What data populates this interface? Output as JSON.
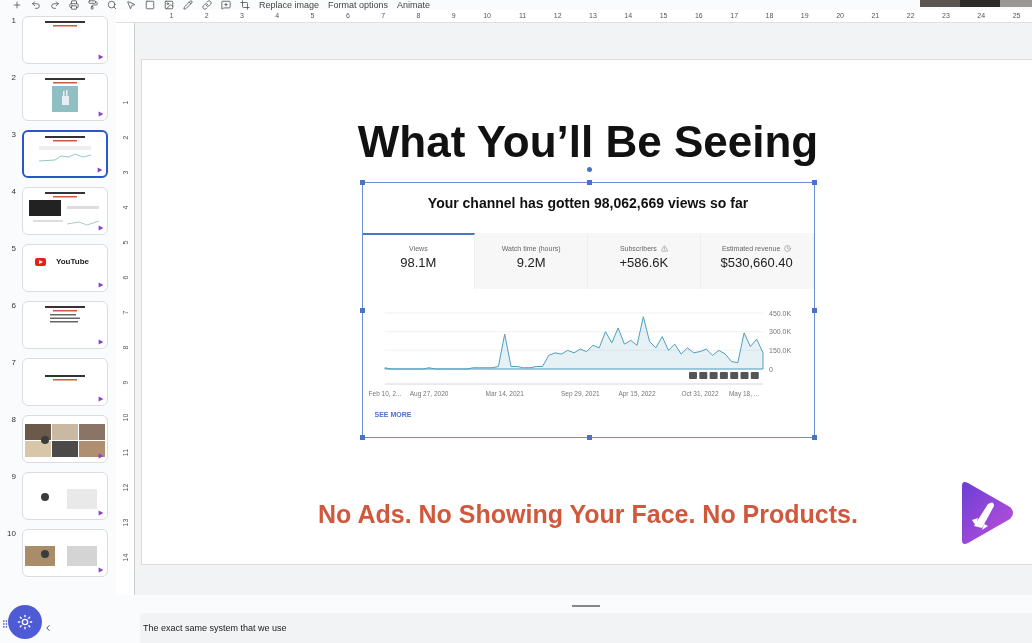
{
  "toolbar": {
    "buttons": [
      "Replace image",
      "Format options",
      "Animate"
    ]
  },
  "rulers": {
    "horizontal": [
      "1",
      "2",
      "3",
      "4",
      "5",
      "6",
      "7",
      "8",
      "9",
      "10",
      "11",
      "12",
      "13",
      "14",
      "15",
      "16",
      "17",
      "18",
      "19",
      "20",
      "21",
      "22",
      "23",
      "24",
      "25"
    ],
    "vertical": [
      "1",
      "2",
      "3",
      "4",
      "5",
      "6",
      "7",
      "8",
      "9",
      "10",
      "11",
      "12",
      "13",
      "14"
    ]
  },
  "slides": [
    {
      "number": "1",
      "kind": "title",
      "selected": false
    },
    {
      "number": "2",
      "selected": false
    },
    {
      "number": "3",
      "kind": "chart",
      "selected": true
    },
    {
      "number": "4",
      "kind": "screenshot",
      "selected": false
    },
    {
      "number": "5",
      "kind": "youtube",
      "selected": false,
      "title": "YouTube"
    },
    {
      "number": "6",
      "kind": "list",
      "selected": false
    },
    {
      "number": "7",
      "kind": "text",
      "selected": false
    },
    {
      "number": "8",
      "kind": "photos",
      "selected": false
    },
    {
      "number": "9",
      "kind": "split",
      "selected": false
    },
    {
      "number": "10",
      "kind": "photos2",
      "selected": false
    }
  ],
  "slide": {
    "title": "What You’ll Be Seeing",
    "caption": "No Ads. No Showing Your Face. No Products.",
    "analytics": {
      "headline": "Your channel has gotten 98,062,669 views so far",
      "tabs": [
        {
          "label": "Views",
          "value": "98.1M",
          "selected": true
        },
        {
          "label": "Watch time (hours)",
          "value": "9.2M",
          "selected": false
        },
        {
          "label": "Subscribers",
          "value": "+586.6K",
          "selected": false
        },
        {
          "label": "Estimated revenue",
          "value": "$530,660.40",
          "selected": false
        }
      ],
      "chart_data": {
        "type": "area",
        "categories": [
          "Feb 10, 2...",
          null,
          null,
          null,
          null,
          null,
          null,
          "Aug 27, 2020",
          null,
          null,
          null,
          null,
          null,
          null,
          null,
          null,
          null,
          null,
          null,
          "Mar 14, 2021",
          null,
          null,
          null,
          null,
          null,
          null,
          null,
          null,
          null,
          null,
          null,
          "Sep 29, 2021",
          null,
          null,
          null,
          null,
          null,
          null,
          null,
          null,
          "Apr 15, 2022",
          null,
          null,
          null,
          null,
          null,
          null,
          null,
          null,
          null,
          "Oct 31, 2022",
          null,
          null,
          null,
          null,
          null,
          null,
          "May 18, ...",
          null,
          null,
          null
        ],
        "series": [
          {
            "color": "#4f9fbf",
            "values": [
              10000,
              0,
              0,
              0,
              0,
              0,
              0,
              10000,
              0,
              0,
              0,
              0,
              0,
              0,
              10000,
              10000,
              10000,
              10000,
              20000,
              280000,
              20000,
              20000,
              10000,
              10000,
              20000,
              20000,
              110000,
              130000,
              120000,
              150000,
              130000,
              160000,
              140000,
              190000,
              170000,
              300000,
              210000,
              330000,
              200000,
              230000,
              190000,
              420000,
              220000,
              170000,
              260000,
              150000,
              200000,
              120000,
              170000,
              130000,
              140000,
              160000,
              110000,
              150000,
              120000,
              60000,
              50000,
              290000,
              180000,
              240000,
              130000
            ]
          }
        ],
        "ylim": [
          0,
          450000
        ],
        "yticks": [
          {
            "value": 0,
            "label": "0"
          },
          {
            "value": 150000,
            "label": "150.0K"
          },
          {
            "value": 300000,
            "label": "300.0K"
          },
          {
            "value": 450000,
            "label": "450.0K"
          }
        ]
      },
      "see_more": "SEE MORE"
    }
  },
  "notes": "The exact same system that we use"
}
